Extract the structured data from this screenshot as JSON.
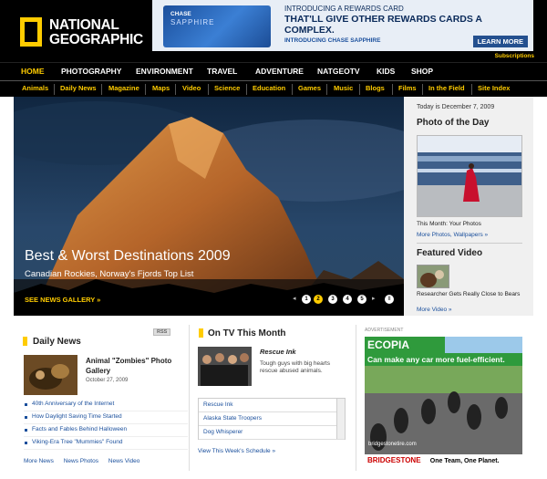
{
  "logo": {
    "line1": "NATIONAL",
    "line2": "GEOGRAPHIC"
  },
  "ad": {
    "card_brand": "CHASE",
    "card_name": "SAPPHIRE",
    "line1": "INTRODUCING A REWARDS CARD",
    "line2": "THAT'LL GIVE OTHER REWARDS CARDS A COMPLEX.",
    "line3": "INTRODUCING CHASE SAPPHIRE",
    "button": "LEARN MORE"
  },
  "subscriptions": "Subscriptions",
  "main_nav": [
    "HOME",
    "PHOTOGRAPHY",
    "ENVIRONMENT",
    "TRAVEL",
    "ADVENTURE",
    "NATGEOTV",
    "KIDS",
    "SHOP"
  ],
  "sub_nav": [
    "Animals",
    "Daily News",
    "Magazine",
    "Maps",
    "Video",
    "Science",
    "Education",
    "Games",
    "Music",
    "Blogs",
    "Films",
    "In the Field",
    "Site Index"
  ],
  "hero": {
    "title": "Best & Worst Destinations 2009",
    "subtitle": "Canadian Rockies, Norway's Fjords Top List",
    "gallery_link": "SEE NEWS GALLERY »",
    "pages": [
      "1",
      "2",
      "3",
      "4",
      "5"
    ],
    "current_page": "2",
    "prev": "◂",
    "next": "▸",
    "pause": "II"
  },
  "sidebar": {
    "today": "Today is December 7, 2009",
    "potd_heading": "Photo of the Day",
    "potd_caption": "This Month: Your Photos",
    "potd_link": "More Photos, Wallpapers »",
    "fv_heading": "Featured Video",
    "fv_caption": "Researcher Gets Really Close to Bears",
    "fv_link": "More Video »"
  },
  "daily_news": {
    "heading": "Daily News",
    "rss": "RSS",
    "feature_title": "Animal \"Zombies\" Photo Gallery",
    "feature_date": "October 27, 2009",
    "items": [
      "40th Anniversary of the Internet",
      "How Daylight Saving Time Started",
      "Facts and Fables Behind Halloween",
      "Viking-Era Tree \"Mummies\" Found"
    ],
    "links": [
      "More News",
      "News Photos",
      "News Video"
    ]
  },
  "on_tv": {
    "heading": "On TV This Month",
    "show": "Rescue Ink",
    "desc": "Tough guys with big hearts rescue abused animals.",
    "list": [
      "Rescue Ink",
      "Alaska State Troopers",
      "Dog Whisperer"
    ],
    "schedule_link": "View This Week's Schedule »"
  },
  "advert": {
    "label": "ADVERTISEMENT",
    "ecopia": "ECOPIA",
    "tagline": "Can make any car more fuel-efficient.",
    "site": "bridgestonetire.com",
    "brand": "BRIDGESTONE",
    "slogan": "One Team, One Planet."
  }
}
